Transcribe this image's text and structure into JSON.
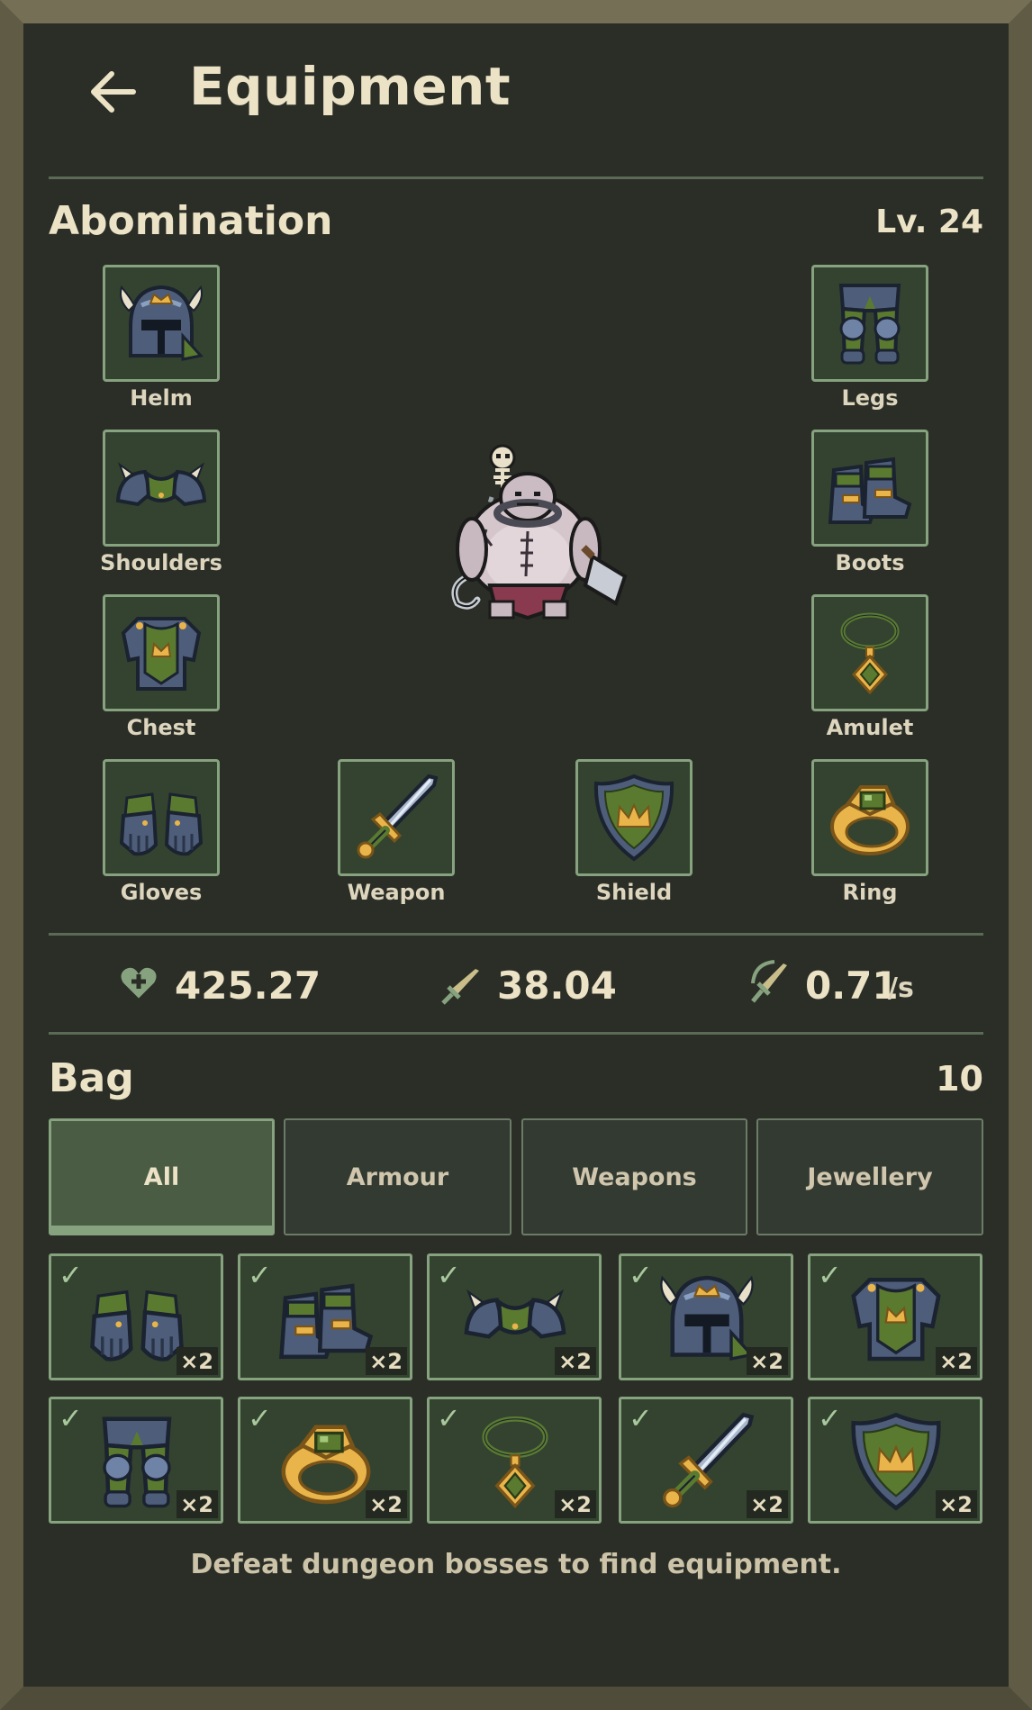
{
  "header": {
    "title": "Equipment",
    "back_icon": "arrow-left-icon"
  },
  "character": {
    "name": "Abomination",
    "level": "Lv. 24"
  },
  "slots": {
    "helm": "Helm",
    "shoulders": "Shoulders",
    "chest": "Chest",
    "gloves": "Gloves",
    "legs": "Legs",
    "boots": "Boots",
    "amulet": "Amulet",
    "ring": "Ring",
    "weapon": "Weapon",
    "shield": "Shield"
  },
  "stats": {
    "health": "425.27",
    "attack": "38.04",
    "speed": "0.71",
    "speed_unit": "/s"
  },
  "bag": {
    "title": "Bag",
    "count": "10",
    "tabs": [
      "All",
      "Armour",
      "Weapons",
      "Jewellery"
    ],
    "active_tab": "All",
    "items": [
      {
        "icon": "gloves-icon",
        "qty": "×2"
      },
      {
        "icon": "boots-icon",
        "qty": "×2"
      },
      {
        "icon": "shoulders-icon",
        "qty": "×2"
      },
      {
        "icon": "helm-icon",
        "qty": "×2"
      },
      {
        "icon": "chest-icon",
        "qty": "×2"
      },
      {
        "icon": "legs-icon",
        "qty": "×2"
      },
      {
        "icon": "ring-icon",
        "qty": "×2"
      },
      {
        "icon": "amulet-icon",
        "qty": "×2"
      },
      {
        "icon": "sword-icon",
        "qty": "×2"
      },
      {
        "icon": "shield-icon",
        "qty": "×2"
      }
    ],
    "check_mark": "✓"
  },
  "footer": "Defeat dungeon bosses to find equipment.",
  "colors": {
    "panel": "#2a2e27",
    "slot_bg": "#33432f",
    "slot_border": "#86a27e",
    "text": "#ece2c6",
    "frame": "#6f6b52"
  }
}
